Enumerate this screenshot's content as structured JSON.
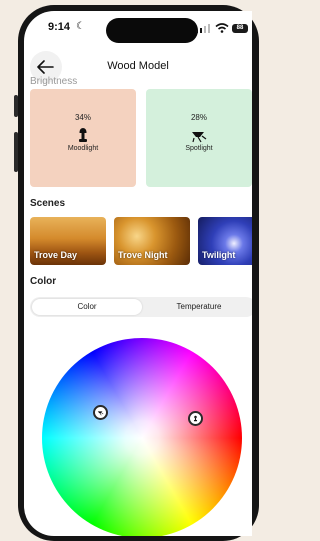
{
  "status": {
    "time": "9:14",
    "battery": "88"
  },
  "header": {
    "title": "Wood Model",
    "faded_section": "Brightness"
  },
  "lights": [
    {
      "name": "Moodlight",
      "brightness": "34%",
      "color": "#f4d2bf",
      "icon": "lamp-icon"
    },
    {
      "name": "Spotlight",
      "brightness": "28%",
      "color": "#d4f0dc",
      "icon": "spotlight-icon"
    }
  ],
  "sections": {
    "scenes": "Scenes",
    "color": "Color"
  },
  "scenes": [
    {
      "name": "Trove Day"
    },
    {
      "name": "Trove Night"
    },
    {
      "name": "Twilight"
    }
  ],
  "color_mode": {
    "options": [
      "Color",
      "Temperature"
    ],
    "selected": "Color"
  }
}
